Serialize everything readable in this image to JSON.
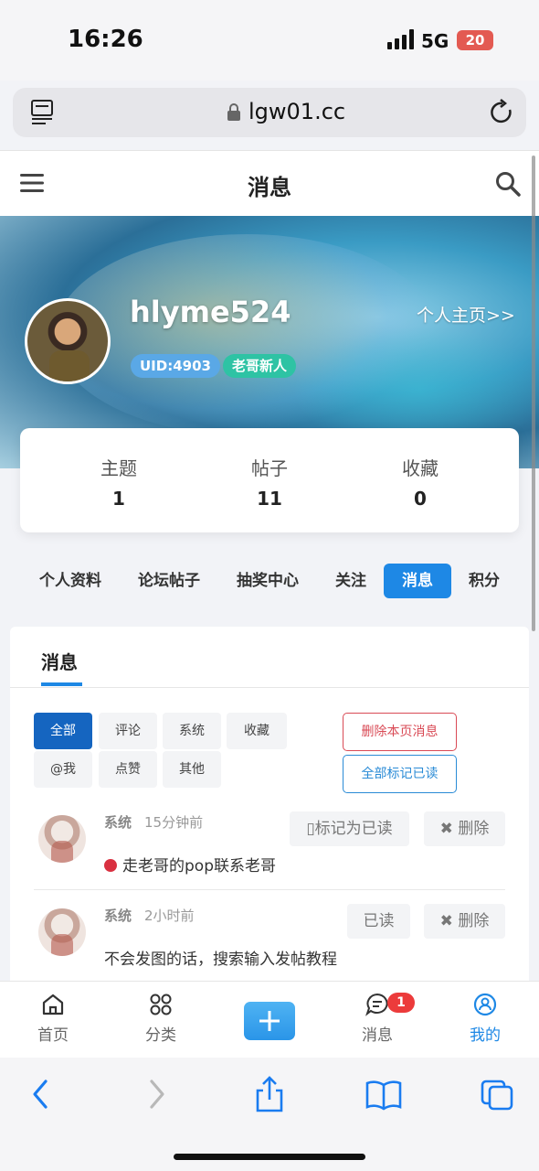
{
  "status_bar": {
    "time": "16:26",
    "network": "5G",
    "battery": "20"
  },
  "browser": {
    "url": "lgw01.cc"
  },
  "header": {
    "title": "消息"
  },
  "profile": {
    "username": "hlyme524",
    "profile_link": "个人主页>>",
    "uid_badge": "UID:4903",
    "level_badge": "老哥新人"
  },
  "stats": [
    {
      "label": "主题",
      "value": "1"
    },
    {
      "label": "帖子",
      "value": "11"
    },
    {
      "label": "收藏",
      "value": "0"
    }
  ],
  "nav_tabs": [
    "个人资料",
    "论坛帖子",
    "抽奖中心",
    "关注",
    "消息",
    "积分"
  ],
  "active_tab": "消息",
  "card": {
    "title": "消息"
  },
  "filters": [
    "全部",
    "评论",
    "系统",
    "收藏",
    "@我",
    "点赞",
    "其他"
  ],
  "actions": {
    "delete_page": "删除本页消息",
    "mark_all_read": "全部标记已读"
  },
  "messages": [
    {
      "sender": "系统",
      "time": "15分钟前",
      "body": "走老哥的pop联系老哥",
      "unread": true,
      "status_button": "标记为已读",
      "delete_button": "删除"
    },
    {
      "sender": "系统",
      "time": "2小时前",
      "body": "不会发图的话，搜索输入发帖教程",
      "unread": false,
      "status_button": "已读",
      "delete_button": "删除"
    }
  ],
  "bottom_nav": {
    "home": "首页",
    "category": "分类",
    "messages": "消息",
    "mine": "我的",
    "message_badge": "1"
  },
  "colors": {
    "accent": "#1e88e5",
    "danger": "#d94a55",
    "badge": "#ec3b3b"
  }
}
